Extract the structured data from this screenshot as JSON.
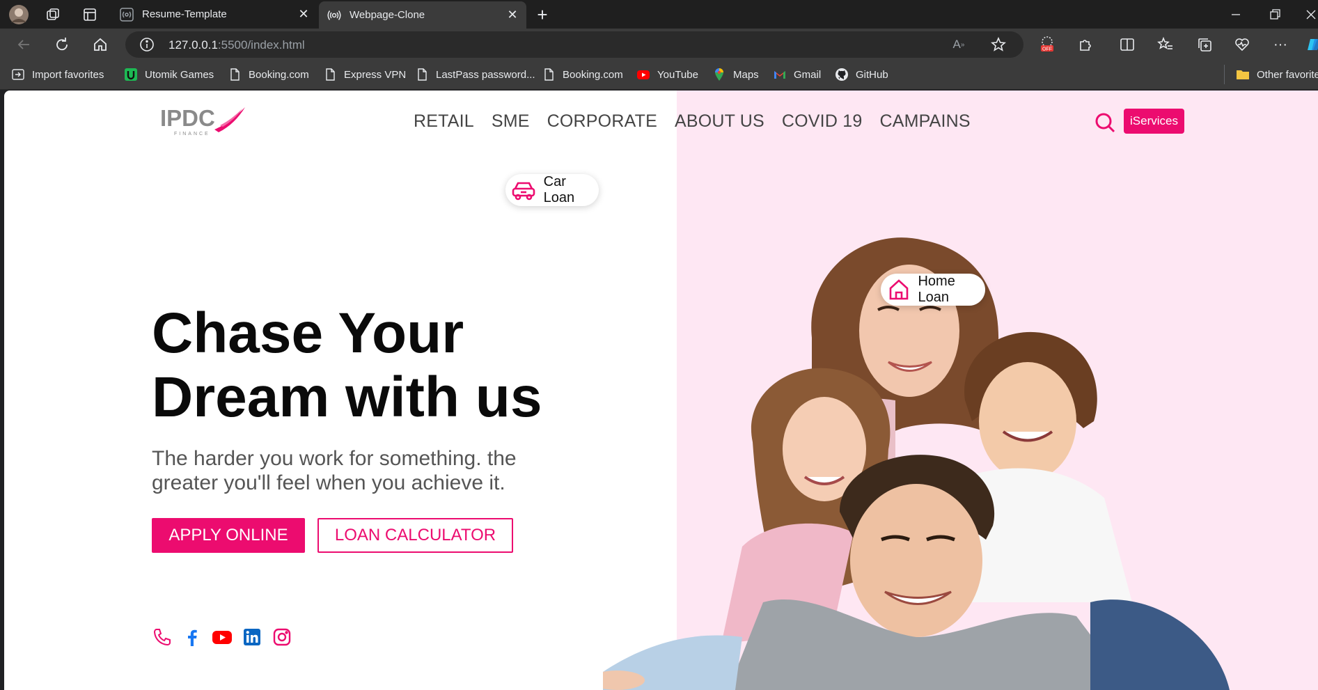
{
  "browser": {
    "tabs": [
      {
        "label": "Resume-Template",
        "active": false
      },
      {
        "label": "Webpage-Clone",
        "active": true
      }
    ],
    "url": {
      "host": "127.0.0.1",
      "rest": ":5500/index.html"
    },
    "bookmarks": [
      {
        "label": "Import favorites",
        "icon": "import-icon"
      },
      {
        "label": "Utomik Games",
        "icon": "utomik-icon"
      },
      {
        "label": "Booking.com",
        "icon": "page-icon"
      },
      {
        "label": "Express VPN",
        "icon": "page-icon"
      },
      {
        "label": "LastPass password...",
        "icon": "page-icon"
      },
      {
        "label": "Booking.com",
        "icon": "page-icon"
      },
      {
        "label": "YouTube",
        "icon": "youtube-icon"
      },
      {
        "label": "Maps",
        "icon": "maps-icon"
      },
      {
        "label": "Gmail",
        "icon": "gmail-icon"
      },
      {
        "label": "GitHub",
        "icon": "github-icon"
      }
    ],
    "other_favorites": "Other favorites"
  },
  "site": {
    "logo_text": "IPDC",
    "logo_sub": "FINANCE",
    "nav": [
      "RETAIL",
      "SME",
      "CORPORATE",
      "ABOUT US",
      "COVID 19",
      "CAMPAINS"
    ],
    "iservices": "iServices",
    "hero": {
      "title_line1": "Chase Your",
      "title_line2": "Dream with us",
      "subtitle": "The harder you work for something. the greater you'll feel when you achieve it.",
      "apply": "APPLY ONLINE",
      "calculator": "LOAN CALCULATOR"
    },
    "pills": {
      "car": "Car Loan",
      "home": "Home Loan"
    },
    "social": [
      "phone-icon",
      "facebook-icon",
      "youtube-icon",
      "linkedin-icon",
      "instagram-icon"
    ]
  },
  "colors": {
    "brand_pink": "#ec0c6f",
    "hero_bg": "#fee7f3"
  }
}
